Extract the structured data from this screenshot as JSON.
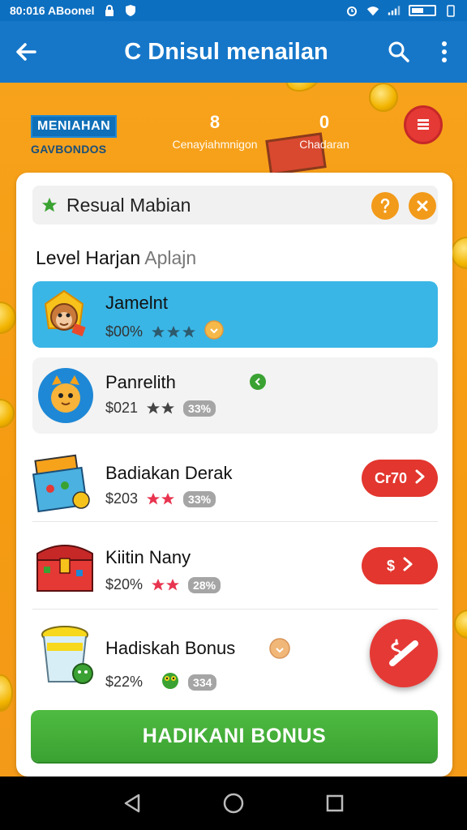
{
  "status_bar": {
    "left_text": "80:016 ABoonel",
    "icons": [
      "lock-icon",
      "shield-icon"
    ],
    "right_icons": [
      "alarm-icon",
      "wifi-icon",
      "signal-icon",
      "battery-icon"
    ]
  },
  "app_bar": {
    "title": "C Dnisul menailan",
    "icons": [
      "back-arrow-icon",
      "search-icon",
      "more-vert-icon"
    ]
  },
  "stats": {
    "badge_label": "MENIAHAN",
    "badge_sub": "GAVBONDOS",
    "stat1_value": "8",
    "stat1_label": "Cenayiahmnigon",
    "stat2_value": "0",
    "stat2_label": "Chadaran"
  },
  "card": {
    "header_title": "Resual Mabian",
    "header_buttons": [
      "help-icon",
      "close-icon"
    ],
    "section_title": "Level Harjan",
    "section_title_suffix": "Aplajn",
    "items": [
      {
        "name": "Jamelnt",
        "price": "$00%",
        "stars": 3,
        "selected": true,
        "icon": "monkey-avatar-icon"
      },
      {
        "name": "Panrelith",
        "price": "$021",
        "stars": 2,
        "percent": "33%",
        "icon": "cat-avatar-icon",
        "status_dot": "green"
      },
      {
        "name": "Badiakan Derak",
        "price": "$203",
        "stars": 2,
        "percent": "33%",
        "action_label": "Cr70",
        "icon": "board-game-icon"
      },
      {
        "name": "Kiitin Nany",
        "price": "$20%",
        "stars": 2,
        "percent": "28%",
        "action_label": "$",
        "icon": "treasure-chest-icon"
      },
      {
        "name": "Hadiskah Bonus",
        "price": "$22%",
        "percent": "334",
        "icon": "bonus-jar-icon"
      }
    ]
  },
  "bonus_button": {
    "label": "HADIKANI BONUS"
  },
  "colors": {
    "app_bar": "#1677c9",
    "status_bar": "#0d6fc0",
    "background": "#f5a623",
    "selected_row": "#3ab6e6",
    "action_red": "#e2362e",
    "bonus_green": "#3aa232"
  }
}
